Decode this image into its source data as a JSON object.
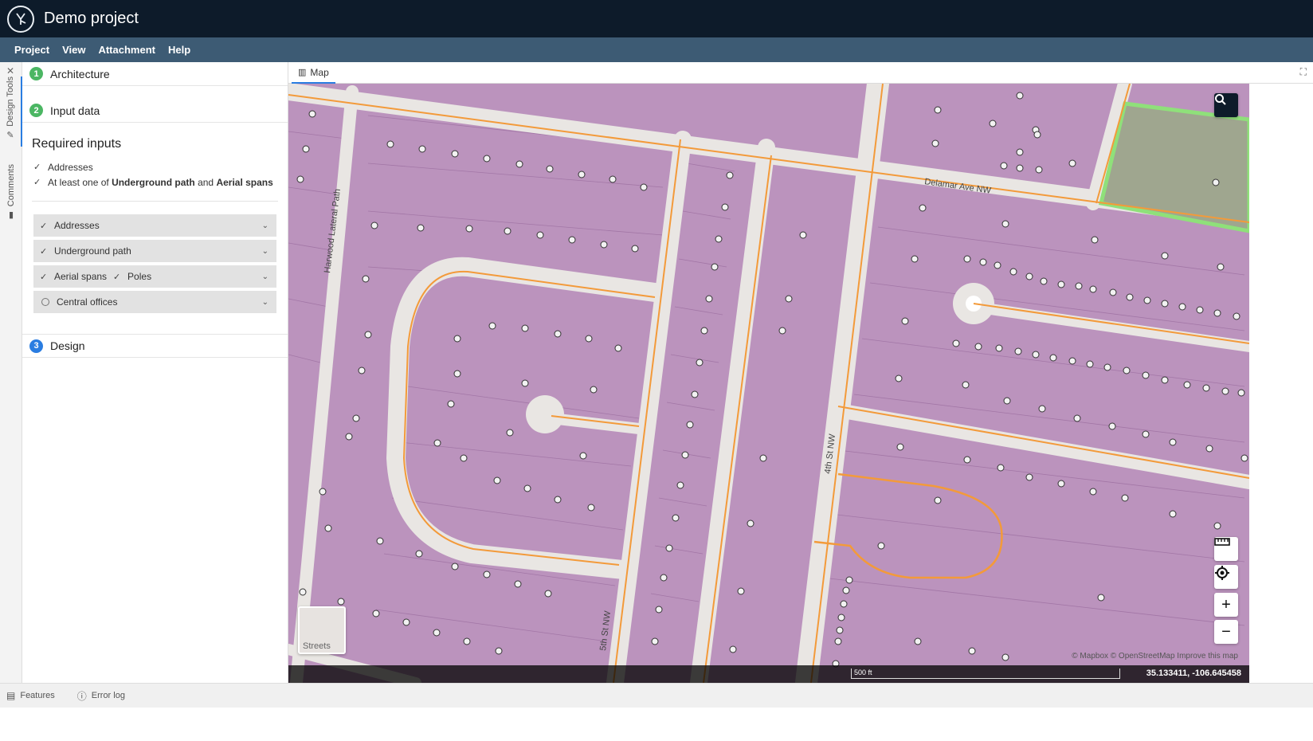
{
  "app": {
    "title": "Demo project"
  },
  "menu": [
    "Project",
    "View",
    "Attachment",
    "Help"
  ],
  "rail": {
    "design_tools": "Design Tools",
    "comments": "Comments"
  },
  "steps": [
    {
      "num": "1",
      "label": "Architecture"
    },
    {
      "num": "2",
      "label": "Input data"
    },
    {
      "num": "3",
      "label": "Design"
    }
  ],
  "required": {
    "title": "Required inputs",
    "item1": "Addresses",
    "item2_prefix": "At least one of",
    "item2_a": "Underground path",
    "item2_and": "and",
    "item2_b": "Aerial spans"
  },
  "dropdowns": {
    "addresses": "Addresses",
    "underground": "Underground path",
    "aerial": "Aerial spans",
    "poles": "Poles",
    "central": "Central offices"
  },
  "map": {
    "tab_label": "Map",
    "streets_label": "Streets",
    "attribution": "© Mapbox © OpenStreetMap Improve this map",
    "scale_label": "500 ft",
    "coords": "35.133411, -106.645458",
    "street_names": {
      "delamar": "Delamar Ave NW",
      "harwood": "Harwood Lateral Path",
      "fourth": "4th St NW",
      "fifth": "5th St NW"
    }
  },
  "bottom": {
    "features": "Features",
    "error_log": "Error log"
  },
  "colors": {
    "titlebar": "#0d1b2a",
    "menubar": "#3d5b74",
    "parcel": "#bb93bd",
    "road": "#e9e6e3",
    "road_line": "#f39a3a",
    "accent": "#2a7de1",
    "green": "#4bb663"
  }
}
